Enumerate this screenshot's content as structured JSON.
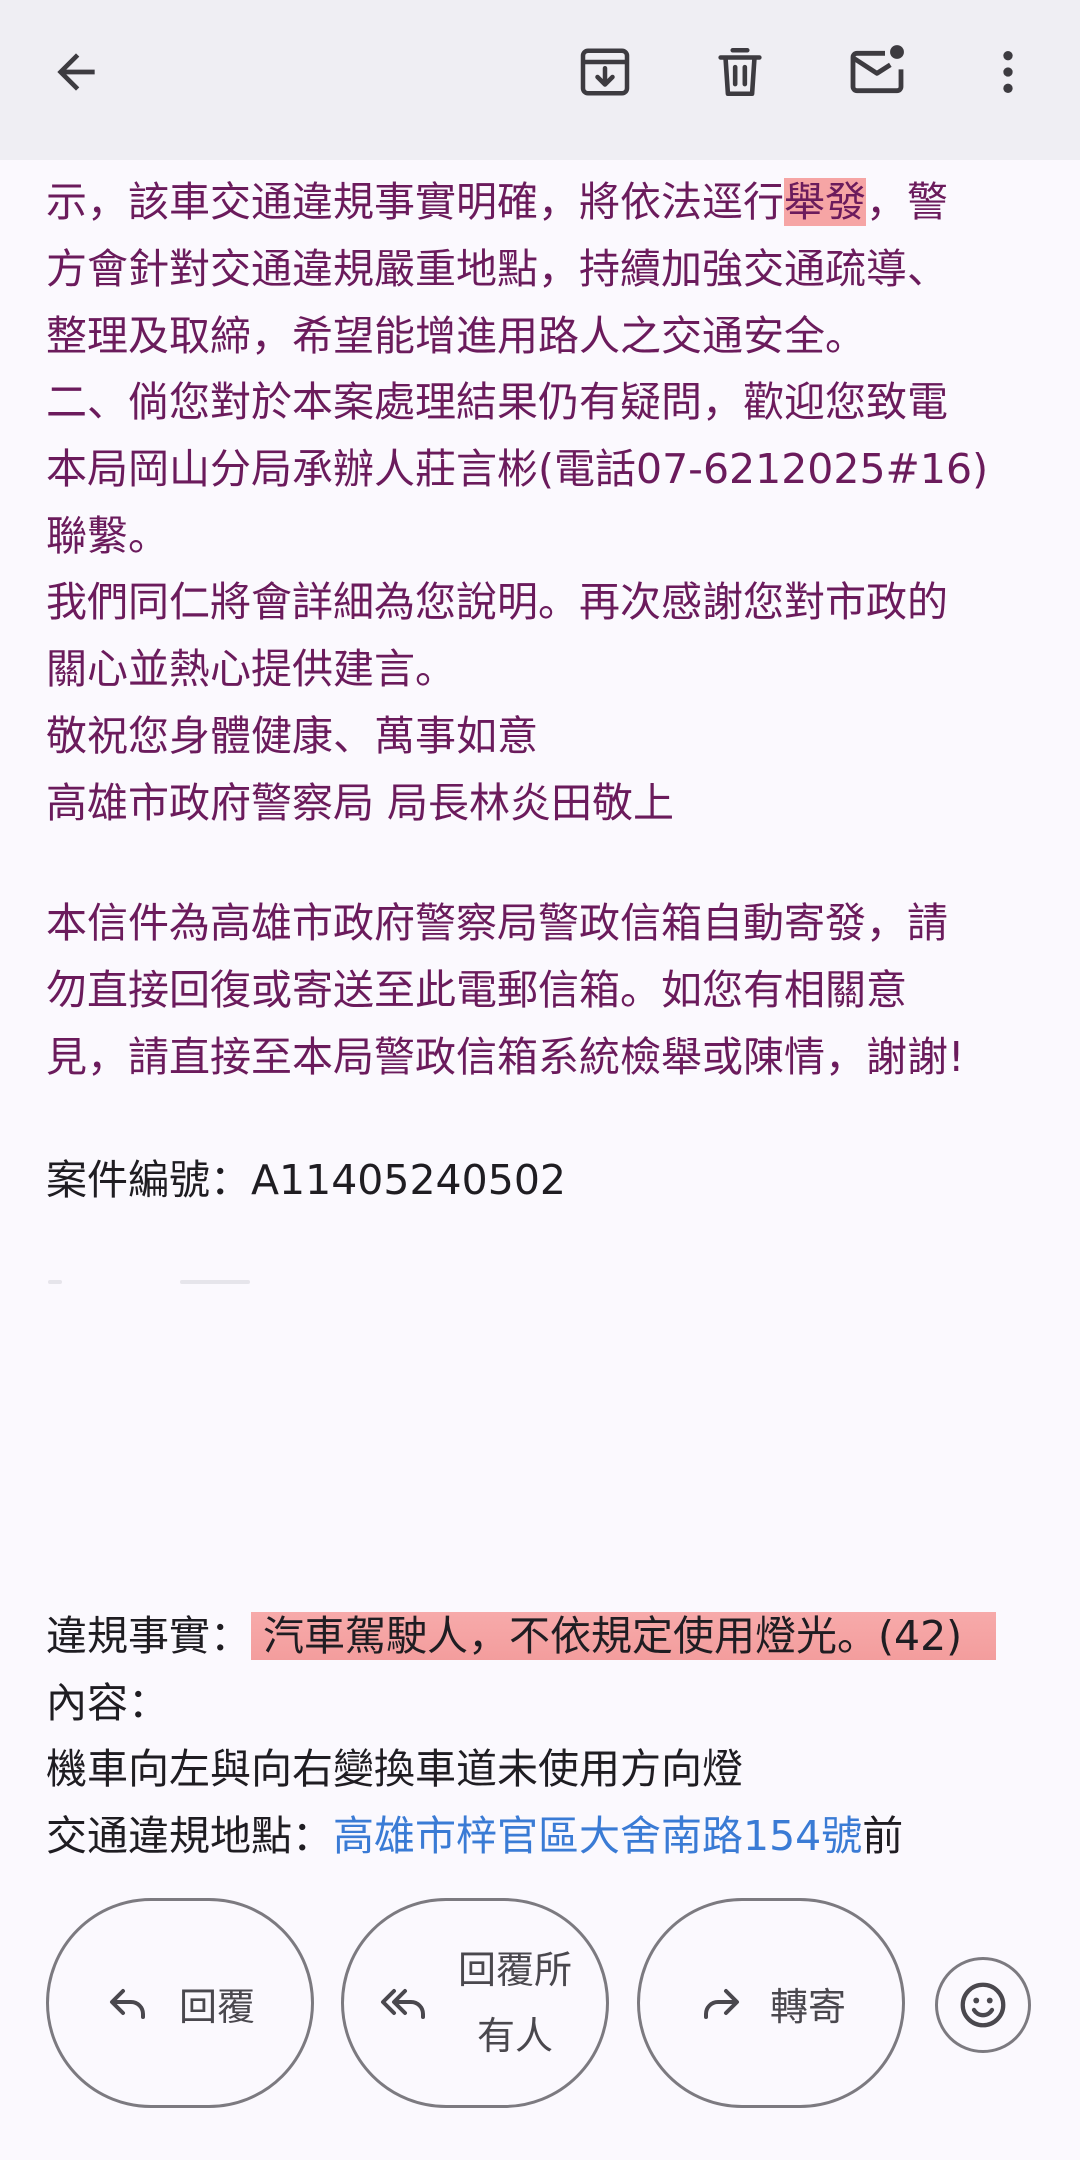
{
  "toolbar": {
    "back_icon": "arrow-back-icon",
    "archive_icon": "archive-icon",
    "delete_icon": "trash-icon",
    "unread_icon": "mark-unread-mail-icon",
    "more_icon": "more-vert-icon"
  },
  "email": {
    "lines": [
      {
        "pre": "示，該車交通違規事實明確，將依法逕行",
        "highlight": "舉發",
        "post": "，警"
      },
      {
        "text": "方會針對交通違規嚴重地點，持續加強交通疏導、"
      },
      {
        "text": "整理及取締，希望能增進用路人之交通安全。"
      },
      {
        "text": "二、倘您對於本案處理結果仍有疑問，歡迎您致電"
      },
      {
        "text": "本局岡山分局承辦人莊言彬(電話07-6212025#16)"
      },
      {
        "text": "聯繫。"
      },
      {
        "text": "我們同仁將會詳細為您說明。再次感謝您對市政的"
      },
      {
        "text": "關心並熱心提供建言。"
      },
      {
        "text": "敬祝您身體健康、萬事如意"
      },
      {
        "text": "高雄市政府警察局 局長林炎田敬上"
      }
    ],
    "notice_lines": [
      "本信件為高雄市政府警察局警政信箱自動寄發，請",
      "勿直接回復或寄送至此電郵信箱。如您有相關意",
      "見，請直接至本局警政信箱系統檢舉或陳情，謝謝!"
    ],
    "case_number": "案件編號：A11405240502",
    "violation_label": "違規事實：",
    "violation_value": "汽車駕駛人，不依規定使用燈光。(42)",
    "content_label": "內容：",
    "content_value": "機車向左與向右變換車道未使用方向燈",
    "location_label": "交通違規地點：",
    "location_link": "高雄市梓官區大舍南路154號",
    "location_suffix": "前"
  },
  "actions": {
    "reply_label": "回覆",
    "reply_all_label_1": "回覆所",
    "reply_all_label_2": "有人",
    "forward_label": "轉寄",
    "emoji_icon": "add-reaction-smiley-icon"
  },
  "colors": {
    "body_text": "#6b1b5c",
    "dark_text": "#1f1d22",
    "highlight": "#f6a5a5",
    "link": "#3a7bd5",
    "toolbar_bg": "#efeef3",
    "page_bg": "#fbf9fe"
  }
}
